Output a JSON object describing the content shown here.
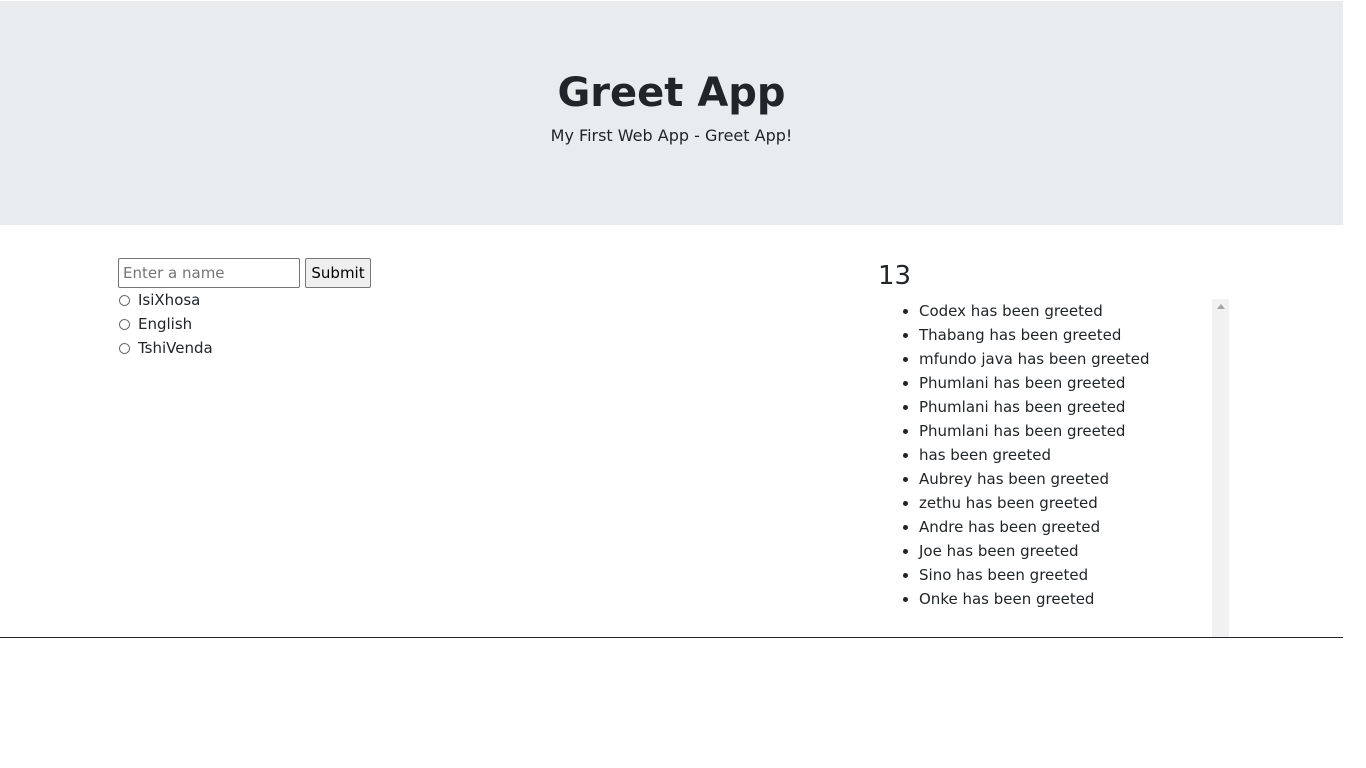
{
  "header": {
    "title": "Greet App",
    "subtitle": "My First Web App - Greet App!"
  },
  "form": {
    "name_placeholder": "Enter a name",
    "name_value": "",
    "submit_label": "Submit",
    "languages": [
      "IsiXhosa",
      "English",
      "TshiVenda"
    ]
  },
  "greetings": {
    "count": "13",
    "items": [
      "Codex has been greeted",
      "Thabang has been greeted",
      "mfundo java has been greeted",
      "Phumlani has been greeted",
      "Phumlani has been greeted",
      "Phumlani has been greeted",
      " has been greeted",
      "Aubrey has been greeted",
      "zethu has been greeted",
      "Andre has been greeted",
      "Joe has been greeted",
      "Sino has been greeted",
      "Onke has been greeted"
    ]
  },
  "colors": {
    "header_bg": "#e9ecef",
    "text": "#212529"
  }
}
